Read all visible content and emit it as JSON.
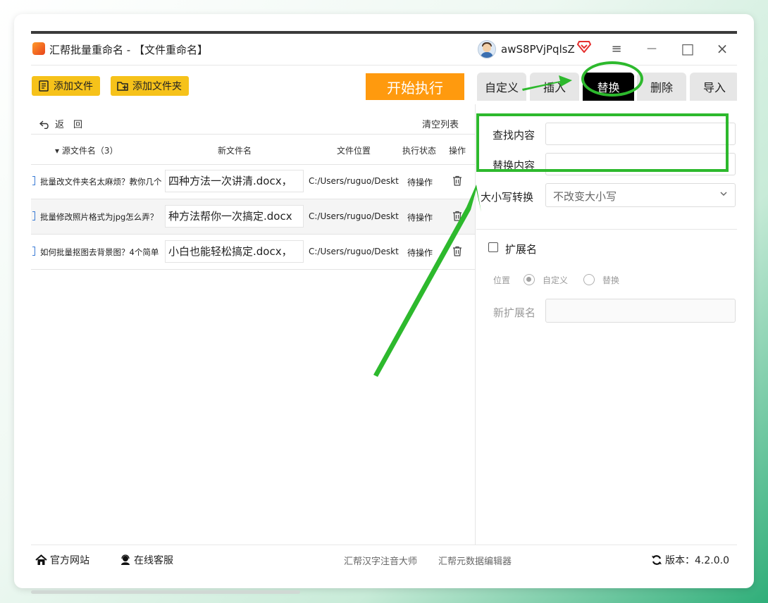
{
  "window": {
    "title": "汇帮批量重命名 - 【文件重命名】",
    "username": "awS8PVjPqlsZ",
    "controls": {
      "menu": "≡",
      "minimize": "—",
      "maximize": "□",
      "close": "×"
    }
  },
  "toolbar": {
    "add_file": "添加文件",
    "add_folder": "添加文件夹",
    "start": "开始执行"
  },
  "tabs": [
    {
      "label": "自定义",
      "active": false
    },
    {
      "label": "插入",
      "active": false
    },
    {
      "label": "替换",
      "active": true
    },
    {
      "label": "删除",
      "active": false
    },
    {
      "label": "导入",
      "active": false
    }
  ],
  "list": {
    "back_label": "返　回",
    "clear_label": "清空列表",
    "headers": {
      "source": "▾ 源文件名（3）",
      "new_name": "新文件名",
      "location": "文件位置",
      "status": "执行状态",
      "action": "操作"
    },
    "rows": [
      {
        "source": "批量改文件夹名太麻烦？教你几个",
        "new_name": "，四种方法一次讲清.docx",
        "path": "C:/Users/ruguo/Deskto",
        "status": "待操作"
      },
      {
        "source": "批量修改照片格式为jpg怎么弄？",
        "new_name": "种方法帮你一次搞定.docx",
        "path": "C:/Users/ruguo/Deskto",
        "status": "待操作"
      },
      {
        "source": "如何批量抠图去背景图？4个简单",
        "new_name": "，小白也能轻松搞定.docx",
        "path": "C:/Users/ruguo/Deskto",
        "status": "待操作"
      }
    ]
  },
  "replace_panel": {
    "find_label": "查找内容",
    "find_value": "",
    "replace_label": "替换内容",
    "replace_value": "",
    "case_label": "大小写转换",
    "case_value": "不改变大小写"
  },
  "extension": {
    "label": "扩展名",
    "checked": false,
    "position_label": "位置",
    "option_custom": "自定义",
    "option_replace": "替换",
    "selected": "自定义",
    "new_ext_label": "新扩展名",
    "new_ext_value": ""
  },
  "footer": {
    "website": "官方网站",
    "support": "在线客服",
    "link1": "汇帮汉字注音大师",
    "link2": "汇帮元数据编辑器",
    "version": "版本：4.2.0.0"
  },
  "colors": {
    "accent_yellow": "#f6c21a",
    "start_orange": "#ff9a0e",
    "active_tab": "#000000",
    "annotation_green": "#2db92d"
  }
}
